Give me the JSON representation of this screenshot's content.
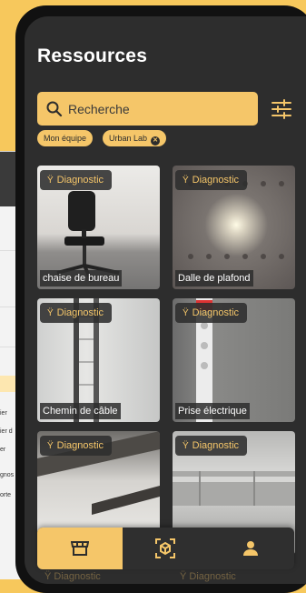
{
  "screen": {
    "title": "Ressources"
  },
  "search": {
    "placeholder": "Recherche",
    "value": ""
  },
  "filters": {
    "chips": [
      {
        "label": "Mon équipe",
        "removable": false
      },
      {
        "label": "Urban Lab",
        "removable": true
      }
    ]
  },
  "cards": [
    {
      "badge": "Diagnostic",
      "name": "chaise de bureau"
    },
    {
      "badge": "Diagnostic",
      "name": "Dalle de plafond"
    },
    {
      "badge": "Diagnostic",
      "name": "Chemin de câble"
    },
    {
      "badge": "Diagnostic",
      "name": "Prise électrique"
    },
    {
      "badge": "Diagnostic",
      "name": ""
    },
    {
      "badge": "Diagnostic",
      "name": ""
    }
  ],
  "ghost_badges": [
    "Diagnostic",
    "Diagnostic"
  ],
  "nav": {
    "items": [
      {
        "icon": "store-icon",
        "active": true
      },
      {
        "icon": "scan-icon",
        "active": false
      },
      {
        "icon": "user-icon",
        "active": false
      }
    ]
  },
  "background_app": {
    "cells": [
      "ier",
      "ier d",
      "er",
      "gnos",
      "orte"
    ]
  },
  "colors": {
    "accent": "#f5c669",
    "surface": "#2d2d2d",
    "background": "#f7c85c"
  }
}
